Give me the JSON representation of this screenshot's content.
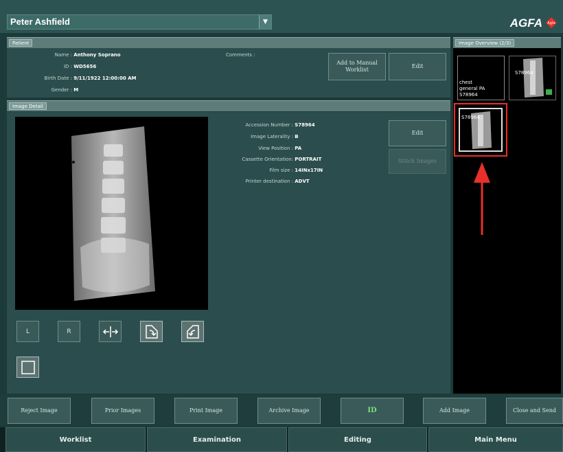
{
  "header": {
    "user_name": "Peter Ashfield",
    "brand": "AGFA",
    "brand_icon_text": "Agfa"
  },
  "patient": {
    "section_label": "Patient",
    "name_label": "Name :",
    "name": "Anthony Soprano",
    "id_label": "ID :",
    "id": "WD5656",
    "birth_label": "Birth Date :",
    "birth": "9/11/1922 12:00:00 AM",
    "gender_label": "Gender :",
    "gender": "M",
    "comments_label": "Comments :",
    "add_worklist_label": "Add to Manual Worklist",
    "edit_label": "Edit"
  },
  "detail": {
    "section_label": "Image Detail",
    "accession_label": "Accession Number :",
    "accession": "S78964",
    "laterality_label": "Image Laterality :",
    "laterality": "B",
    "view_label": "View Position :",
    "view": "PA",
    "cassette_label": "Cassette Orientation:",
    "cassette": "PORTRAIT",
    "film_label": "Film size :",
    "film": "14INx17IN",
    "printer_label": "Printer destination :",
    "printer": "ADVT",
    "edit_label": "Edit",
    "stitch_label": "Stitch Images",
    "tool_l": "L",
    "tool_r": "R"
  },
  "overview": {
    "section_label": "Image Overview (2/3)",
    "thumb1_text_1": "chest",
    "thumb1_text_2": "general PA",
    "thumb1_text_3": "S78964",
    "thumb2_text": "S78964",
    "thumb3_text": "S78964"
  },
  "actions": {
    "reject": "Reject Image",
    "prior": "Prior Images",
    "print": "Print Image",
    "archive": "Archive Image",
    "id": "ID",
    "add": "Add Image",
    "close": "Close and Send"
  },
  "tabs": [
    "Worklist",
    "Examination",
    "Editing",
    "Main Menu"
  ],
  "colors": {
    "accent_red": "#e8302a",
    "id_green": "#7fe07f"
  }
}
